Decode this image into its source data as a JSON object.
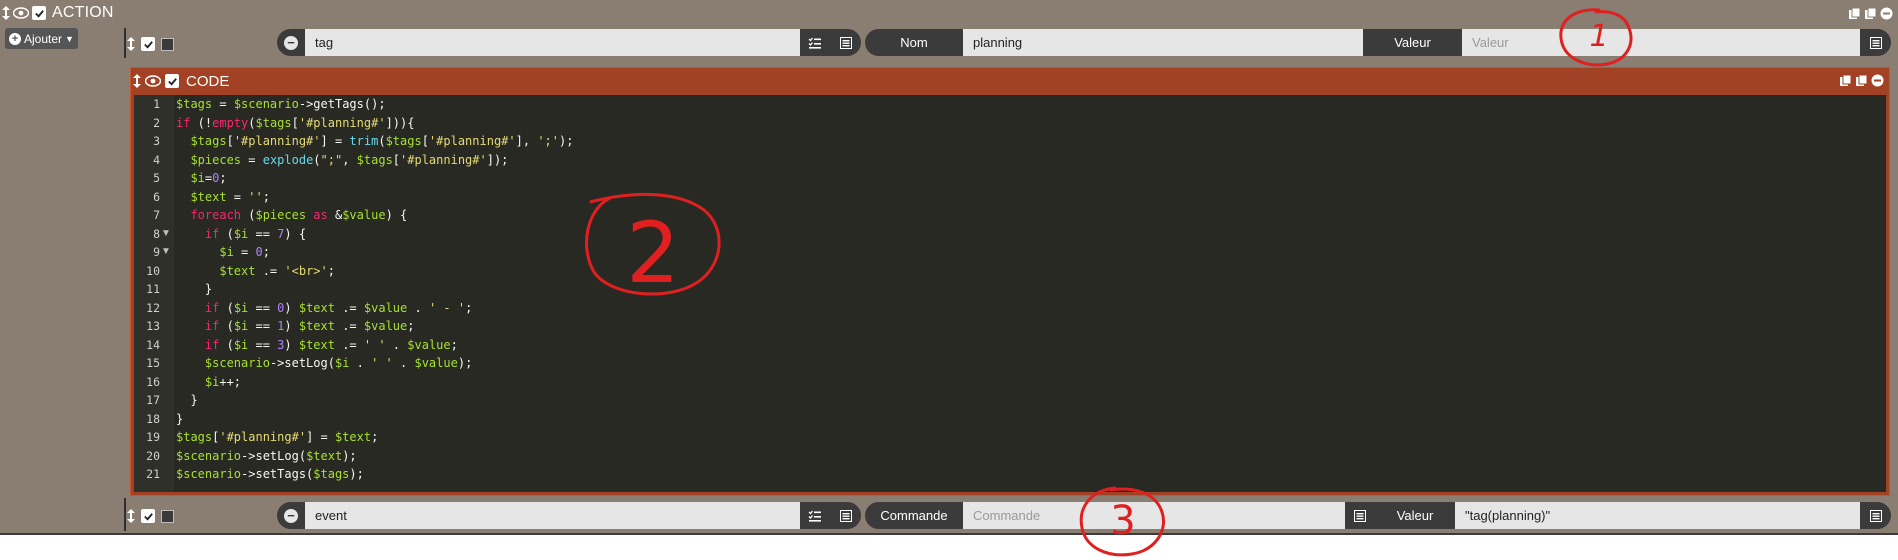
{
  "action_block": {
    "title": "ACTION",
    "add_button_label": "Ajouter"
  },
  "row1": {
    "tags_value": "tag",
    "name_label": "Nom",
    "name_value": "planning",
    "value_label": "Valeur",
    "value_placeholder": "Valeur"
  },
  "code_block": {
    "title": "CODE",
    "lines": [
      "1",
      "2",
      "3",
      "4",
      "5",
      "6",
      "7",
      "8",
      "9",
      "10",
      "11",
      "12",
      "13",
      "14",
      "15",
      "16",
      "17",
      "18",
      "19",
      "20",
      "21"
    ]
  },
  "row3": {
    "event_value": "event",
    "command_label": "Commande",
    "command_placeholder": "Commande",
    "value_label": "Valeur",
    "value_value": "\"tag(planning)\""
  },
  "annotations": [
    "1",
    "2",
    "3"
  ],
  "colors": {
    "panel": "#8a7d72",
    "code_header": "#a24124",
    "code_bg": "#282923",
    "annotation": "#e02020"
  }
}
